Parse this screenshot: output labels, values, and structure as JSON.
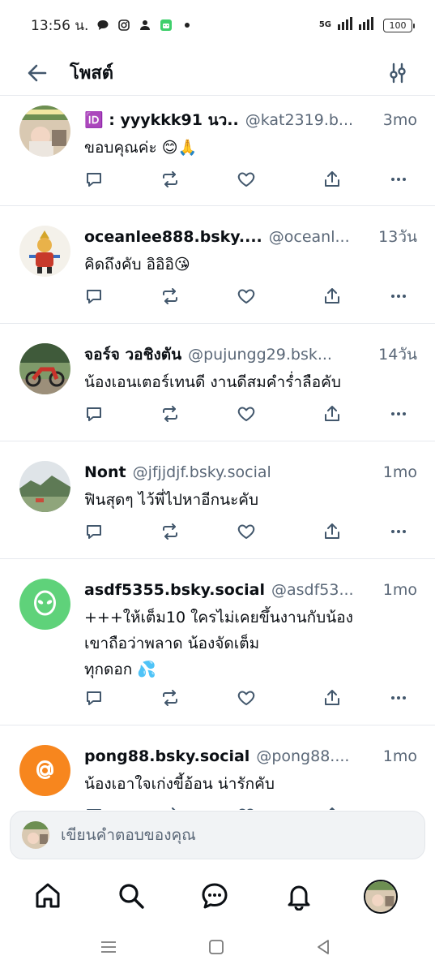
{
  "status_bar": {
    "time": "13:56 น.",
    "network": "5G",
    "battery": "100",
    "icons": [
      "chat-bubble-icon",
      "instagram-icon",
      "person-icon",
      "android-app-icon",
      "dot-icon"
    ]
  },
  "header": {
    "title": "โพสต์",
    "back_icon": "arrow-left-icon",
    "filter_icon": "sliders-icon"
  },
  "posts": [
    {
      "name": "🆔 : yyykkk91 นว..",
      "handle": "@kat2319.b...",
      "time": "3mo",
      "text": "ขอบคุณค่ะ 😊🙏",
      "avatar": "photo-avatar-1"
    },
    {
      "name": "oceanlee888.bsky....",
      "handle": "@oceanl...",
      "time": "13วัน",
      "text": "คิดถึงคับ อิอิอิ😘",
      "avatar": "cartoon-warrior-avatar"
    },
    {
      "name": "จอร์จ วอชิงตัน",
      "handle": "@pujungg29.bsk...",
      "time": "14วัน",
      "text": "น้องเอนเตอร์เทนดี งานดีสมคำร่ำลือคับ",
      "avatar": "motorcycle-avatar"
    },
    {
      "name": "Nont",
      "handle": "@jfjjdjf.bsky.social",
      "time": "1mo",
      "text": "ฟินสุดๆ  ไว้พี่ไปหาอีกนะคับ",
      "avatar": "landscape-avatar"
    },
    {
      "name": "asdf5355.bsky.social",
      "handle": "@asdf53...",
      "time": "1mo",
      "text": "+++ให้เต็ม10 ใครไม่เคยขึ้นงานกับน้อง\nเขาถือว่าพลาด น้องจัดเต็ม\nทุกดอก 💦",
      "avatar": "alien-avatar",
      "avatar_color": "#5fd27a"
    },
    {
      "name": "pong88.bsky.social",
      "handle": "@pong88....",
      "time": "1mo",
      "text": "น้องเอาใจเก่งขี้อ้อน น่ารักคับ",
      "avatar": "at-sign-avatar",
      "avatar_color": "#f7861e"
    }
  ],
  "reply": {
    "placeholder": "เขียนคำตอบของคุณ"
  },
  "bottom_nav": [
    "home-icon",
    "search-icon",
    "chat-icon",
    "bell-icon",
    "profile-avatar"
  ],
  "system_nav": [
    "recents-icon",
    "home-square-icon",
    "back-triangle-icon"
  ],
  "colors": {
    "text": "#0b0f14",
    "muted": "#5b6878",
    "icon": "#42576c",
    "divider": "#e6e9ee",
    "accent": "#1083fe"
  }
}
